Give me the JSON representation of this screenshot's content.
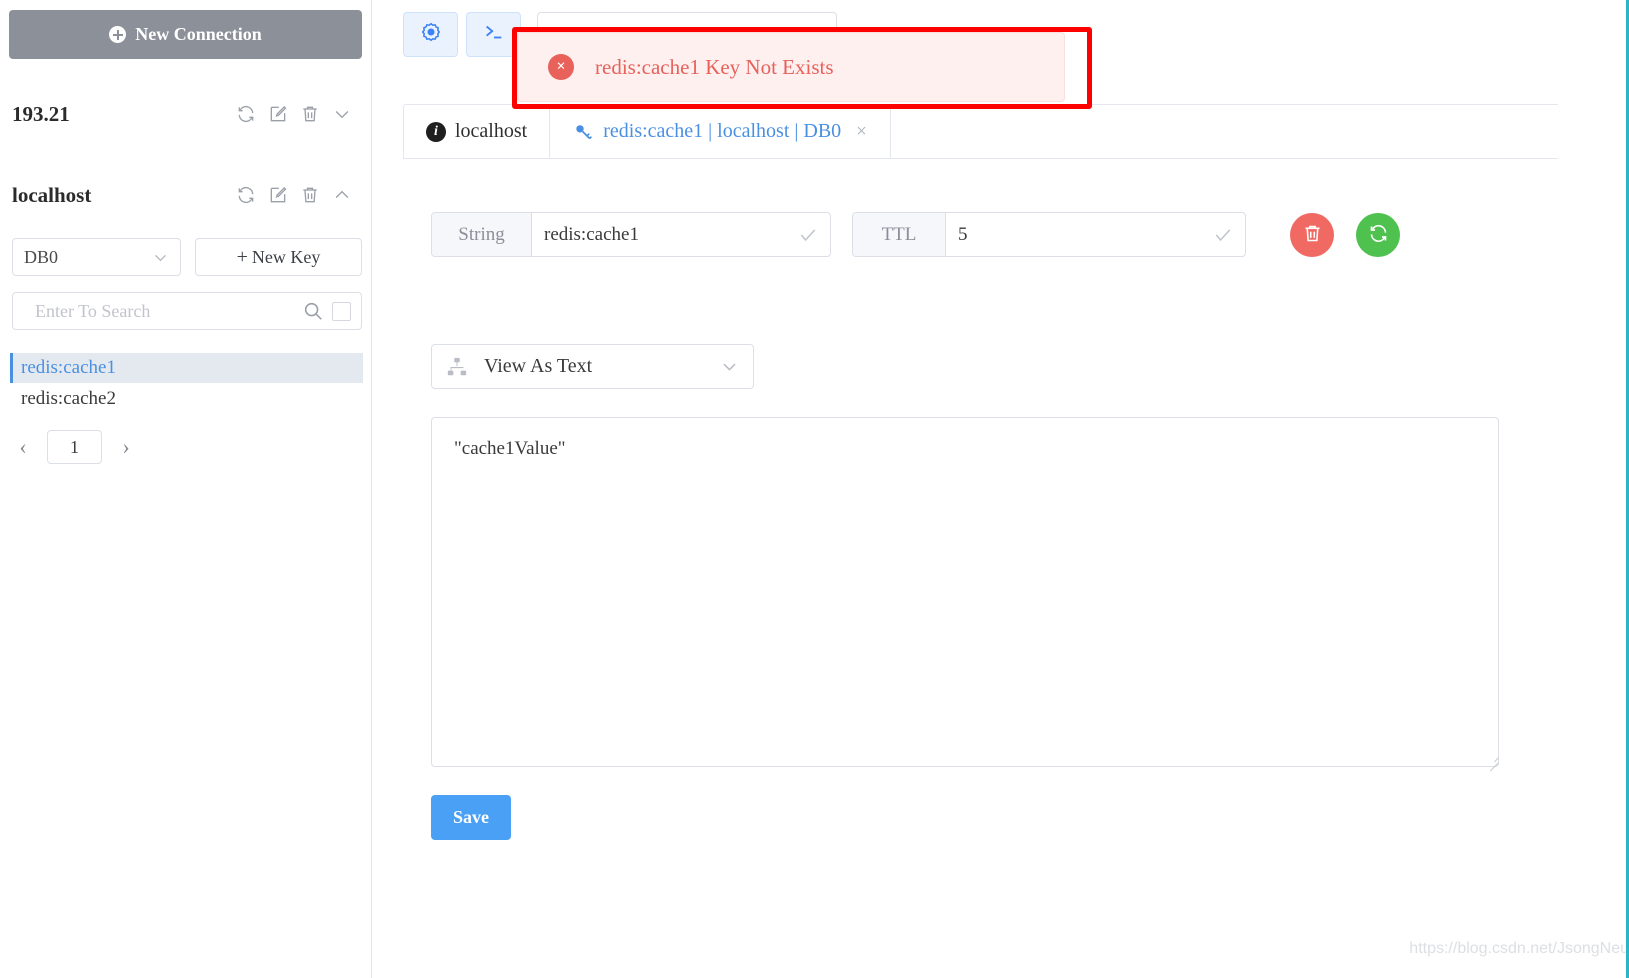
{
  "sidebar": {
    "new_connection_label": "New Connection",
    "new_connection_icon": "plus-circle-icon",
    "connections": [
      {
        "name": "193.21",
        "expanded": false,
        "chevron": "chevron-down-icon"
      },
      {
        "name": "localhost",
        "expanded": true,
        "chevron": "chevron-up-icon"
      }
    ],
    "row_icons": [
      "refresh-icon",
      "edit-icon",
      "trash-icon"
    ],
    "db_select": {
      "value": "DB0",
      "chevron": "chevron-down-icon"
    },
    "new_key_label": "New Key",
    "new_key_icon": "plus-icon",
    "search": {
      "placeholder": "Enter To Search",
      "value": "",
      "icon": "search-icon",
      "checkbox": "select-all-checkbox"
    },
    "keys": [
      {
        "label": "redis:cache1",
        "selected": true
      },
      {
        "label": "redis:cache2",
        "selected": false
      }
    ],
    "pager": {
      "prev_icon": "chevron-left-icon",
      "next_icon": "chevron-right-icon",
      "page": "1"
    }
  },
  "toolbar": {
    "settings_icon": "gear-icon",
    "console_icon": "terminal-icon",
    "search": {
      "placeholder": "",
      "value": ""
    }
  },
  "tabs": [
    {
      "label": "localhost",
      "icon": "info-icon",
      "active": true,
      "closable": false
    },
    {
      "label": "redis:cache1 | localhost | DB0",
      "icon": "key-icon",
      "active": false,
      "closable": true,
      "close_icon": "close-icon"
    }
  ],
  "toast": {
    "message": "redis:cache1 Key Not Exists",
    "icon": "error-circle-icon",
    "icon_glyph": "×",
    "bg_color": "#fdf0ef",
    "text_color": "#e8615b",
    "highlight_border_color": "#ff0000"
  },
  "editor": {
    "type_field": {
      "label": "String",
      "value": "redis:cache1",
      "check_icon": "check-icon"
    },
    "ttl_field": {
      "label": "TTL",
      "value": "5",
      "check_icon": "check-icon"
    },
    "delete_button": {
      "icon": "trash-icon",
      "color": "#f06a63"
    },
    "refresh_button": {
      "icon": "refresh-icon",
      "color": "#4fc14f"
    },
    "view_as": {
      "label": "View As Text",
      "icon": "sitemap-icon",
      "chevron": "chevron-down-icon"
    },
    "value": "\"cache1Value\"",
    "save_label": "Save",
    "save_color": "#49a0f5"
  },
  "watermark": "https://blog.csdn.net/JsongNeu"
}
